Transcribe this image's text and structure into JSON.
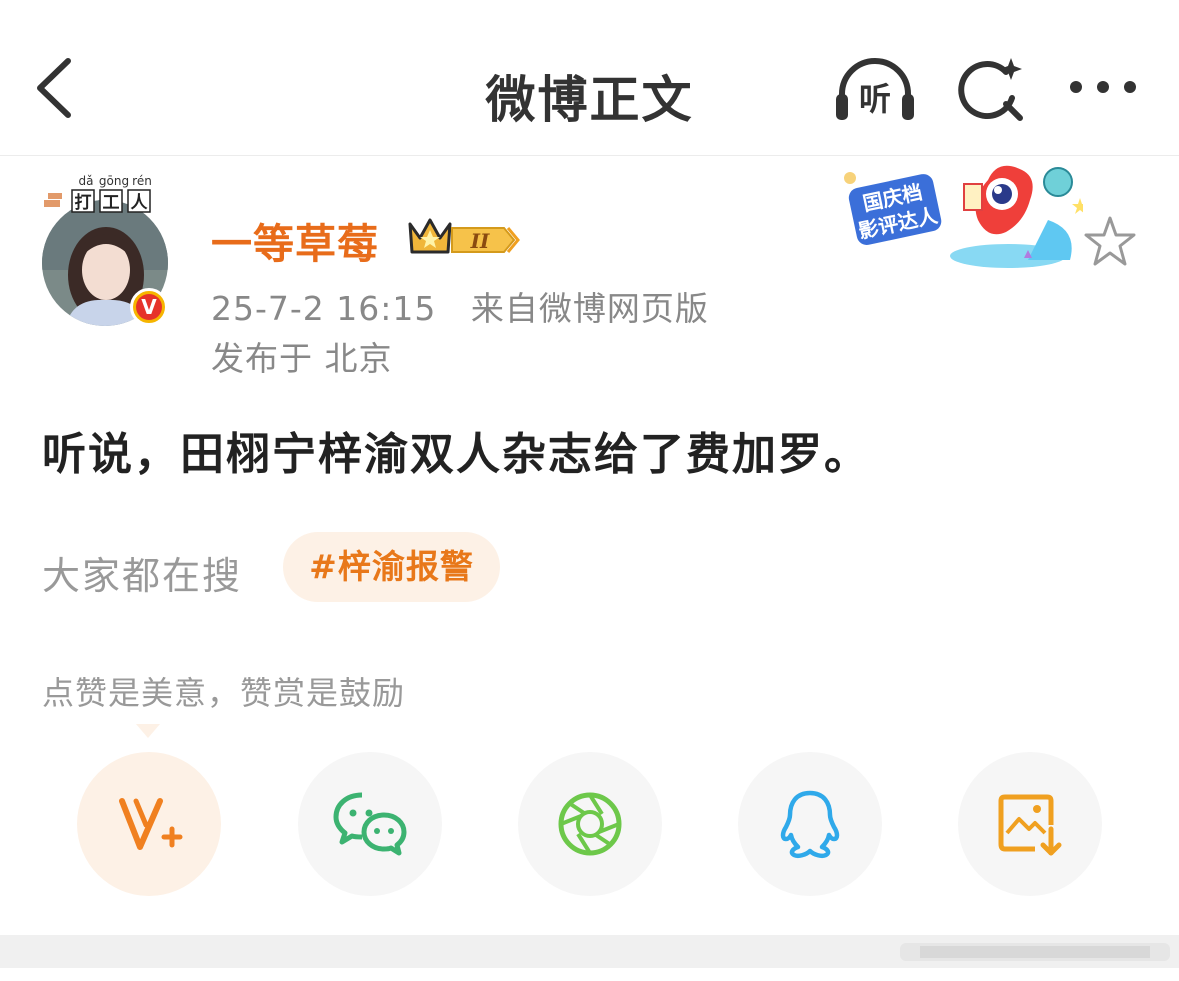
{
  "header": {
    "title": "微博正文",
    "listen_label": "听",
    "icons": [
      "back-icon",
      "listen-icon",
      "search-icon",
      "more-icon"
    ]
  },
  "post": {
    "avatar_frame_pinyin": [
      "dǎ",
      "gōng",
      "rén"
    ],
    "avatar_frame_text": [
      "打",
      "工",
      "人"
    ],
    "verified_badge": "V",
    "username": "一等草莓",
    "user_level": "II",
    "timestamp": "25-7-2 16:15",
    "source": "来自微博网页版",
    "location": "发布于 北京",
    "event_badge_text": [
      "国庆档",
      "影评达人"
    ],
    "text": "听说，田栩宁梓渝双人杂志给了费加罗。"
  },
  "trending": {
    "label": "大家都在搜",
    "hashtag": "#梓渝报警"
  },
  "reward": {
    "text": "点赞是美意，赞赏是鼓励"
  },
  "share": {
    "items": [
      "vplus-icon",
      "wechat-icon",
      "moments-icon",
      "qq-icon",
      "save-image-icon"
    ]
  },
  "colors": {
    "username": "#e86c1a",
    "hashtag_bg": "#fdf1e6",
    "hashtag_text": "#e8781a",
    "wechat": "#3cb371",
    "moments": "#6dc84a",
    "qq": "#2fa9ea",
    "save": "#f0a020"
  }
}
